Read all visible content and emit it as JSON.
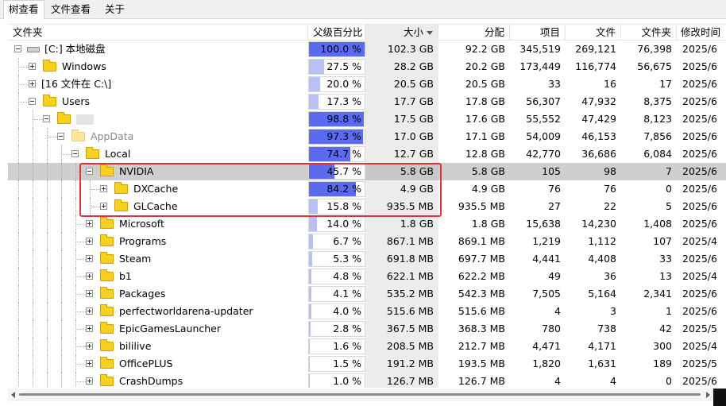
{
  "tabs": [
    {
      "label": "树查看",
      "active": true
    },
    {
      "label": "文件查看",
      "active": false
    },
    {
      "label": "关于",
      "active": false
    }
  ],
  "columns": {
    "name": "文件夹",
    "pct": "父级百分比",
    "size": "大小",
    "alloc": "分配",
    "items": "项目",
    "files": "文件",
    "folders": "文件夹",
    "mtime": "修改时间"
  },
  "sort_column": "size",
  "accent_colors": {
    "bar_light": "#b8c0f4",
    "bar_strong": "#5a6bf0",
    "highlight": "#e0303a",
    "folder": "#f7d11c"
  },
  "rows": [
    {
      "name": "[C:] 本地磁盘",
      "pct": "100.0 %",
      "pct_value": 100.0,
      "size": "102.3 GB",
      "alloc": "92.2 GB",
      "items": "345,519",
      "files": "269,121",
      "folders": "76,398",
      "mtime": "2025/6",
      "icon": "drive-icon"
    },
    {
      "name": "Windows",
      "pct": "27.5 %",
      "pct_value": 27.5,
      "size": "28.2 GB",
      "alloc": "20.2 GB",
      "items": "173,449",
      "files": "116,774",
      "folders": "56,675",
      "mtime": "2025/6",
      "icon": "folder-icon"
    },
    {
      "name": "[16 文件在 C:\\]",
      "pct": "20.0 %",
      "pct_value": 20.0,
      "size": "20.5 GB",
      "alloc": "20.5 GB",
      "items": "33",
      "files": "16",
      "folders": "17",
      "mtime": "2025/6",
      "icon": "none"
    },
    {
      "name": "Users",
      "pct": "17.3 %",
      "pct_value": 17.3,
      "size": "17.7 GB",
      "alloc": "17.8 GB",
      "items": "56,307",
      "files": "47,932",
      "folders": "8,375",
      "mtime": "2025/6",
      "icon": "folder-icon"
    },
    {
      "name": "",
      "pct": "98.8 %",
      "pct_value": 98.8,
      "size": "17.5 GB",
      "alloc": "17.6 GB",
      "items": "55,552",
      "files": "47,429",
      "folders": "8,123",
      "mtime": "2025/6",
      "icon": "folder-icon"
    },
    {
      "name": "AppData",
      "pct": "97.3 %",
      "pct_value": 97.3,
      "size": "17.0 GB",
      "alloc": "17.1 GB",
      "items": "54,009",
      "files": "46,153",
      "folders": "7,856",
      "mtime": "2025/6",
      "icon": "folder-icon"
    },
    {
      "name": "Local",
      "pct": "74.7 %",
      "pct_value": 74.7,
      "size": "12.7 GB",
      "alloc": "12.8 GB",
      "items": "42,770",
      "files": "36,686",
      "folders": "6,084",
      "mtime": "2025/6",
      "icon": "folder-icon"
    },
    {
      "name": "NVIDIA",
      "pct": "45.7 %",
      "pct_value": 45.7,
      "size": "5.8 GB",
      "alloc": "5.8 GB",
      "items": "105",
      "files": "98",
      "folders": "7",
      "mtime": "2025/6",
      "icon": "folder-icon"
    },
    {
      "name": "DXCache",
      "pct": "84.2 %",
      "pct_value": 84.2,
      "size": "4.9 GB",
      "alloc": "4.9 GB",
      "items": "76",
      "files": "76",
      "folders": "0",
      "mtime": "2025/6",
      "icon": "folder-icon"
    },
    {
      "name": "GLCache",
      "pct": "15.8 %",
      "pct_value": 15.8,
      "size": "935.5 MB",
      "alloc": "935.5 MB",
      "items": "27",
      "files": "22",
      "folders": "5",
      "mtime": "2025/6",
      "icon": "folder-icon"
    },
    {
      "name": "Microsoft",
      "pct": "14.0 %",
      "pct_value": 14.0,
      "size": "1.8 GB",
      "alloc": "1.8 GB",
      "items": "15,638",
      "files": "14,230",
      "folders": "1,408",
      "mtime": "2025/6",
      "icon": "folder-icon"
    },
    {
      "name": "Programs",
      "pct": "6.7 %",
      "pct_value": 6.7,
      "size": "867.1 MB",
      "alloc": "869.1 MB",
      "items": "1,219",
      "files": "1,112",
      "folders": "107",
      "mtime": "2025/4",
      "icon": "folder-icon"
    },
    {
      "name": "Steam",
      "pct": "5.3 %",
      "pct_value": 5.3,
      "size": "691.8 MB",
      "alloc": "697.7 MB",
      "items": "4,441",
      "files": "4,408",
      "folders": "33",
      "mtime": "2025/6",
      "icon": "folder-icon"
    },
    {
      "name": "b1",
      "pct": "4.8 %",
      "pct_value": 4.8,
      "size": "622.1 MB",
      "alloc": "622.2 MB",
      "items": "49",
      "files": "36",
      "folders": "13",
      "mtime": "2025/4",
      "icon": "folder-icon"
    },
    {
      "name": "Packages",
      "pct": "4.1 %",
      "pct_value": 4.1,
      "size": "535.2 MB",
      "alloc": "542.3 MB",
      "items": "7,505",
      "files": "5,164",
      "folders": "2,341",
      "mtime": "2025/6",
      "icon": "folder-icon"
    },
    {
      "name": "perfectworldarena-updater",
      "pct": "4.0 %",
      "pct_value": 4.0,
      "size": "515.6 MB",
      "alloc": "515.6 MB",
      "items": "4",
      "files": "3",
      "folders": "1",
      "mtime": "2025/6",
      "icon": "folder-icon"
    },
    {
      "name": "EpicGamesLauncher",
      "pct": "2.8 %",
      "pct_value": 2.8,
      "size": "367.5 MB",
      "alloc": "368.3 MB",
      "items": "780",
      "files": "738",
      "folders": "42",
      "mtime": "2025/5",
      "icon": "folder-icon"
    },
    {
      "name": "bililive",
      "pct": "1.6 %",
      "pct_value": 1.6,
      "size": "208.5 MB",
      "alloc": "212.7 MB",
      "items": "4,471",
      "files": "4,171",
      "folders": "300",
      "mtime": "2025/4",
      "icon": "folder-icon"
    },
    {
      "name": "OfficePLUS",
      "pct": "1.5 %",
      "pct_value": 1.5,
      "size": "191.2 MB",
      "alloc": "193.5 MB",
      "items": "1,820",
      "files": "1,631",
      "folders": "189",
      "mtime": "2025/5",
      "icon": "folder-icon"
    },
    {
      "name": "CrashDumps",
      "pct": "1.0 %",
      "pct_value": 1.0,
      "size": "126.7 MB",
      "alloc": "126.7 MB",
      "items": "4",
      "files": "4",
      "folders": "0",
      "mtime": "2025/6",
      "icon": "folder-icon"
    }
  ],
  "selected_row": "NVIDIA"
}
